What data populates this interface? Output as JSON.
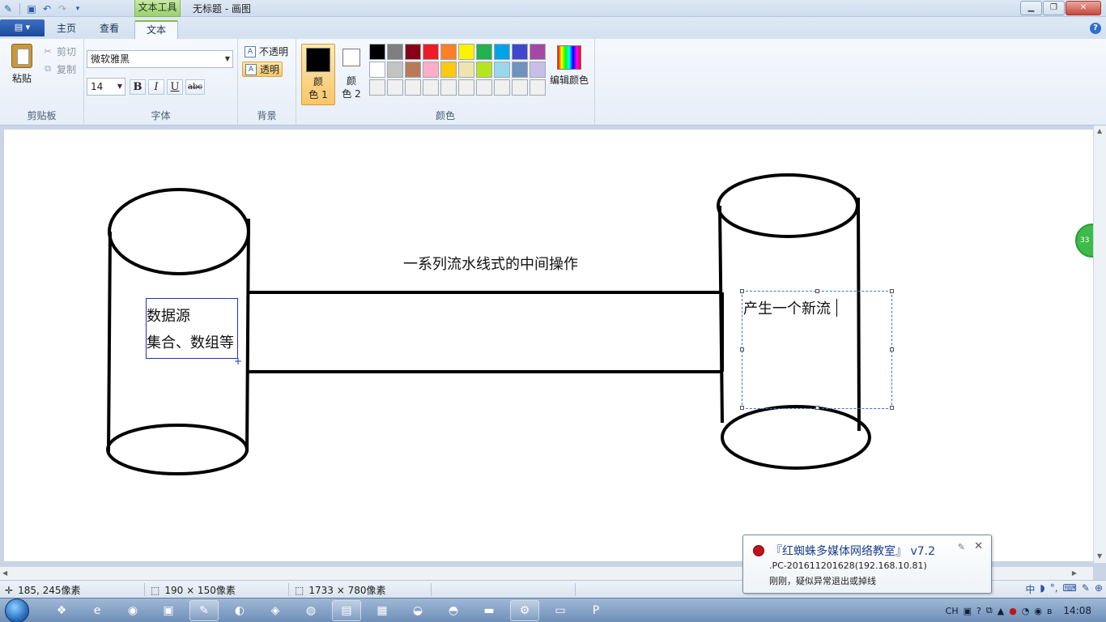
{
  "window": {
    "title": "无标题 - 画图",
    "context_tab_header": "文本工具"
  },
  "tabs": [
    {
      "label": "主页"
    },
    {
      "label": "查看"
    },
    {
      "label": "文本"
    }
  ],
  "clipboard": {
    "paste": "粘贴",
    "cut": "剪切",
    "copy": "复制",
    "group": "剪贴板"
  },
  "font": {
    "family": "微软雅黑",
    "size": "14",
    "bold": "B",
    "italic": "I",
    "underline": "U",
    "strike": "abc",
    "group": "字体"
  },
  "background": {
    "opaque": "不透明",
    "transparent": "透明",
    "group": "背景"
  },
  "colors": {
    "color1_label": "颜\n色 1",
    "color1_a": "颜",
    "color1_b": "色 1",
    "color2_a": "颜",
    "color2_b": "色 2",
    "edit": "编辑颜色",
    "group": "颜色",
    "color1_value": "#000000",
    "color2_value": "#ffffff",
    "palette": [
      "#000000",
      "#7f7f7f",
      "#880015",
      "#ed1c24",
      "#ff7f27",
      "#fff200",
      "#22b14c",
      "#00a2e8",
      "#3f48cc",
      "#a349a4",
      "#ffffff",
      "#c3c3c3",
      "#b97a57",
      "#ffaec9",
      "#ffc90e",
      "#efe4b0",
      "#b5e61d",
      "#99d9ea",
      "#7092be",
      "#c8bfe7",
      "#f0f0f0",
      "#f0f0f0",
      "#f0f0f0",
      "#f0f0f0",
      "#f0f0f0",
      "#f0f0f0",
      "#f0f0f0",
      "#f0f0f0",
      "#f0f0f0",
      "#f0f0f0"
    ]
  },
  "canvas": {
    "left_text_1": "数据源",
    "left_text_2": "集合、数组等",
    "middle_text": "一系列流水线式的中间操作",
    "right_text": "产生一个新流",
    "badge": "33"
  },
  "status": {
    "cursor": "185, 245像素",
    "selection": "190 × 150像素",
    "image_size": "1733 × 780像素"
  },
  "balloon": {
    "title": "『红蜘蛛多媒体网络教室』 v7.2",
    "line1": ".PC-201611201628(192.168.10.81)",
    "line2": "刚刚，疑似异常退出或掉线"
  },
  "taskbar": {
    "clock": "14:08",
    "ime": "CH",
    "ime_mode": "中"
  }
}
